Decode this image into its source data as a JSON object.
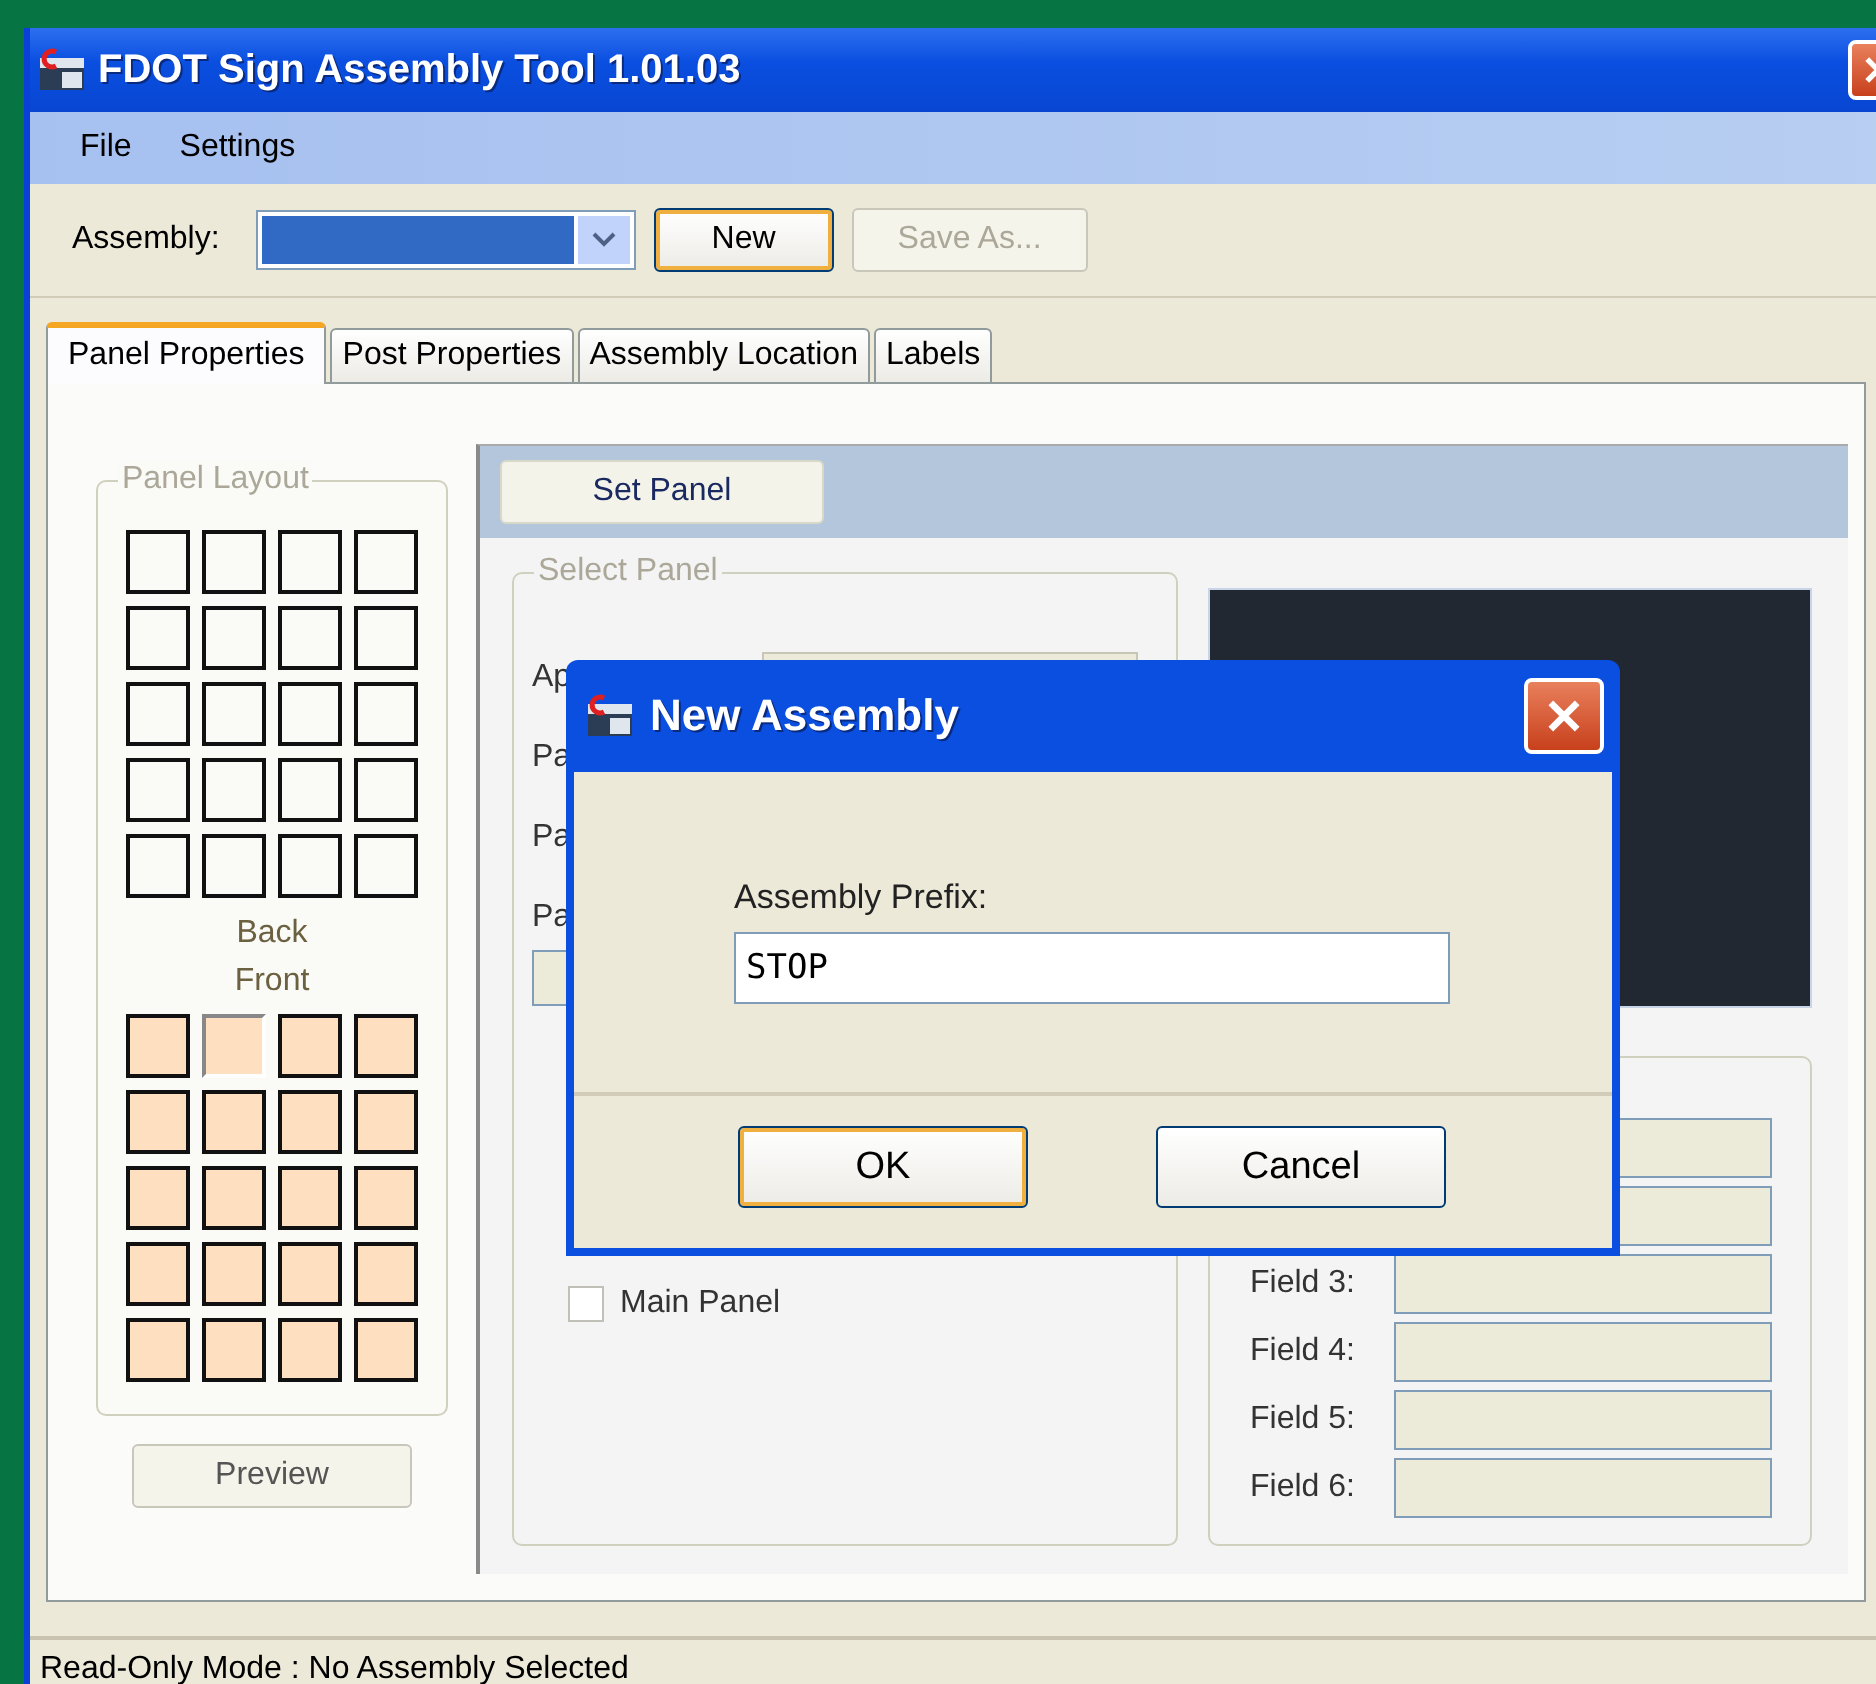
{
  "window": {
    "title": "FDOT Sign Assembly Tool 1.01.03"
  },
  "menu": [
    {
      "label": "File"
    },
    {
      "label": "Settings"
    }
  ],
  "toolbar": {
    "assembly_label": "Assembly:",
    "assembly_combo": {
      "highlighted": true
    },
    "buttons": [
      {
        "label": "New",
        "default": true,
        "disabled": false
      },
      {
        "label": "Save As...",
        "default": false,
        "disabled": true
      }
    ]
  },
  "tabs": [
    {
      "label": "Panel Properties",
      "selected": true
    },
    {
      "label": "Post Properties",
      "selected": false
    },
    {
      "label": "Assembly Location",
      "selected": false
    },
    {
      "label": "Labels",
      "selected": false
    }
  ],
  "panel_layout": {
    "title": "Panel Layout",
    "back_label": "Back",
    "front_label": "Front",
    "back_cells": [
      {
        "pressed": false
      },
      {
        "pressed": false
      },
      {
        "pressed": false
      },
      {
        "pressed": false
      },
      {
        "pressed": false
      },
      {
        "pressed": false
      },
      {
        "pressed": false
      },
      {
        "pressed": false
      },
      {
        "pressed": false
      },
      {
        "pressed": false
      },
      {
        "pressed": false
      },
      {
        "pressed": false
      },
      {
        "pressed": false
      },
      {
        "pressed": false
      },
      {
        "pressed": false
      },
      {
        "pressed": false
      },
      {
        "pressed": false
      },
      {
        "pressed": false
      },
      {
        "pressed": false
      },
      {
        "pressed": false
      }
    ],
    "front_cells": [
      {
        "pressed": false
      },
      {
        "pressed": true
      },
      {
        "pressed": false
      },
      {
        "pressed": false
      },
      {
        "pressed": false
      },
      {
        "pressed": false
      },
      {
        "pressed": false
      },
      {
        "pressed": false
      },
      {
        "pressed": false
      },
      {
        "pressed": false
      },
      {
        "pressed": false
      },
      {
        "pressed": false
      },
      {
        "pressed": false
      },
      {
        "pressed": false
      },
      {
        "pressed": false
      },
      {
        "pressed": false
      },
      {
        "pressed": false
      },
      {
        "pressed": false
      },
      {
        "pressed": false
      },
      {
        "pressed": false
      }
    ],
    "preview_button": "Preview"
  },
  "set_panel_button": "Set Panel",
  "select_panel": {
    "title": "Select Panel",
    "row_labels": [
      "Ap",
      "Pa",
      "Pa",
      "Pa"
    ],
    "main_panel": {
      "label": "Main Panel",
      "checked": false
    }
  },
  "fields": [
    {
      "kind": "covered"
    },
    {
      "kind": "covered"
    },
    {
      "kind": "labeled",
      "label": "Field 3:"
    },
    {
      "kind": "labeled",
      "label": "Field 4:"
    },
    {
      "kind": "labeled",
      "label": "Field 5:"
    },
    {
      "kind": "labeled",
      "label": "Field 6:"
    }
  ],
  "dialog": {
    "title": "New Assembly",
    "prefix_label": "Assembly Prefix:",
    "prefix_value": "STOP",
    "buttons": [
      {
        "label": "OK",
        "default": true
      },
      {
        "label": "Cancel",
        "default": false
      }
    ]
  },
  "status_bar": "Read-Only Mode : No Assembly Selected"
}
